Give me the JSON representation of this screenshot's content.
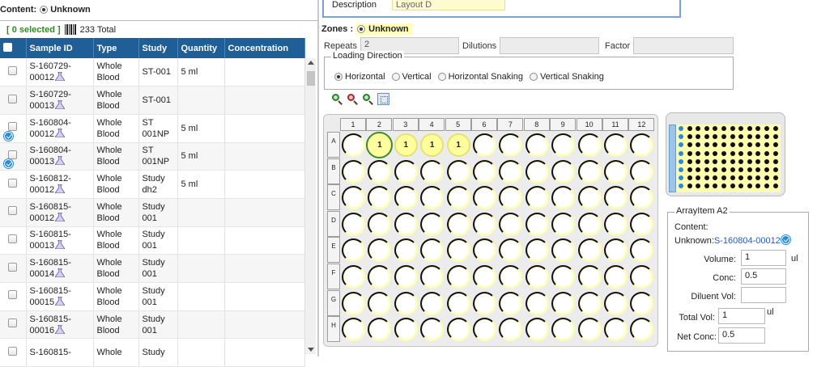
{
  "left_panel": {
    "content_label": "Content:",
    "content_value": "Unknown",
    "selected_text": "[ 0 selected ]",
    "total_text": "233 Total",
    "columns": [
      "Sample ID",
      "Type",
      "Study",
      "Quantity",
      "Concentration"
    ],
    "rows": [
      {
        "id1": "S-160729-",
        "id2": "00012",
        "type1": "Whole",
        "type2": "Blood",
        "study1": "ST-001",
        "study2": "",
        "qty": "5 ml",
        "conc": "",
        "status": false
      },
      {
        "id1": "S-160729-",
        "id2": "00013",
        "type1": "Whole",
        "type2": "Blood",
        "study1": "ST-001",
        "study2": "",
        "qty": "",
        "conc": "",
        "status": false
      },
      {
        "id1": "S-160804-",
        "id2": "00012",
        "type1": "Whole",
        "type2": "Blood",
        "study1": "ST",
        "study2": "001NP",
        "qty": "5 ml",
        "conc": "",
        "status": true
      },
      {
        "id1": "S-160804-",
        "id2": "00013",
        "type1": "Whole",
        "type2": "Blood",
        "study1": "ST",
        "study2": "001NP",
        "qty": "5 ml",
        "conc": "",
        "status": true
      },
      {
        "id1": "S-160812-",
        "id2": "00012",
        "type1": "Whole",
        "type2": "Blood",
        "study1": "Study",
        "study2": "dh2",
        "qty": "5 ml",
        "conc": "",
        "status": false
      },
      {
        "id1": "S-160815-",
        "id2": "00012",
        "type1": "Whole",
        "type2": "Blood",
        "study1": "Study",
        "study2": "001",
        "qty": "",
        "conc": "",
        "status": false
      },
      {
        "id1": "S-160815-",
        "id2": "00013",
        "type1": "Whole",
        "type2": "Blood",
        "study1": "Study",
        "study2": "001",
        "qty": "",
        "conc": "",
        "status": false
      },
      {
        "id1": "S-160815-",
        "id2": "00014",
        "type1": "Whole",
        "type2": "Blood",
        "study1": "Study",
        "study2": "001",
        "qty": "",
        "conc": "",
        "status": false
      },
      {
        "id1": "S-160815-",
        "id2": "00015",
        "type1": "Whole",
        "type2": "Blood",
        "study1": "Study",
        "study2": "001",
        "qty": "",
        "conc": "",
        "status": false
      },
      {
        "id1": "S-160815-",
        "id2": "00016",
        "type1": "Whole",
        "type2": "Blood",
        "study1": "Study",
        "study2": "001",
        "qty": "",
        "conc": "",
        "status": false
      },
      {
        "id1": "S-160815-",
        "id2": "",
        "type1": "Whole",
        "type2": "",
        "study1": "Study",
        "study2": "",
        "qty": "",
        "conc": "",
        "status": false
      }
    ]
  },
  "right_panel": {
    "description_label": "Description",
    "description_value": "Layout D",
    "zones_label": "Zones :",
    "zones_value": "Unknown",
    "repeats_label": "Repeats",
    "repeats_value": "2",
    "dilutions_label": "Dilutions",
    "dilutions_value": "",
    "factor_label": "Factor",
    "factor_value": "",
    "loading_direction_label": "Loading Direction",
    "loading_options": [
      "Horizontal",
      "Vertical",
      "Horizontal Snaking",
      "Vertical Snaking"
    ],
    "loading_selected": "Horizontal",
    "zoom_tools": [
      "zoom-in-icon",
      "zoom-out-icon",
      "zoom-reset-icon",
      "fit-icon"
    ]
  },
  "plate": {
    "columns": [
      "1",
      "2",
      "3",
      "4",
      "5",
      "6",
      "7",
      "8",
      "9",
      "10",
      "11",
      "12"
    ],
    "rows": [
      "A",
      "B",
      "C",
      "D",
      "E",
      "F",
      "G",
      "H"
    ],
    "filled_wells": {
      "A2": "1",
      "A3": "1",
      "A4": "1",
      "A5": "1"
    },
    "selected_well": "A2",
    "empty_first_column": true
  },
  "array_item": {
    "title": "ArrayItem A2",
    "content_label": "Content:",
    "content_prefix": "Unknown:",
    "content_link": "S-160804-00012",
    "volume_label": "Volume:",
    "volume_value": "1",
    "volume_unit": "ul",
    "conc_label": "Conc:",
    "conc_value": "0.5",
    "diluent_label": "Diluent Vol:",
    "diluent_value": "",
    "total_label": "Total Vol:",
    "total_value": "1",
    "total_unit": "ul",
    "net_label": "Net Conc:",
    "net_value": "0.5"
  },
  "colors": {
    "header_blue": "#1f5e96",
    "well_yellow": "#ffff9e",
    "selected_green": "#3c8a2a",
    "status_blue": "#2a8ad6"
  }
}
